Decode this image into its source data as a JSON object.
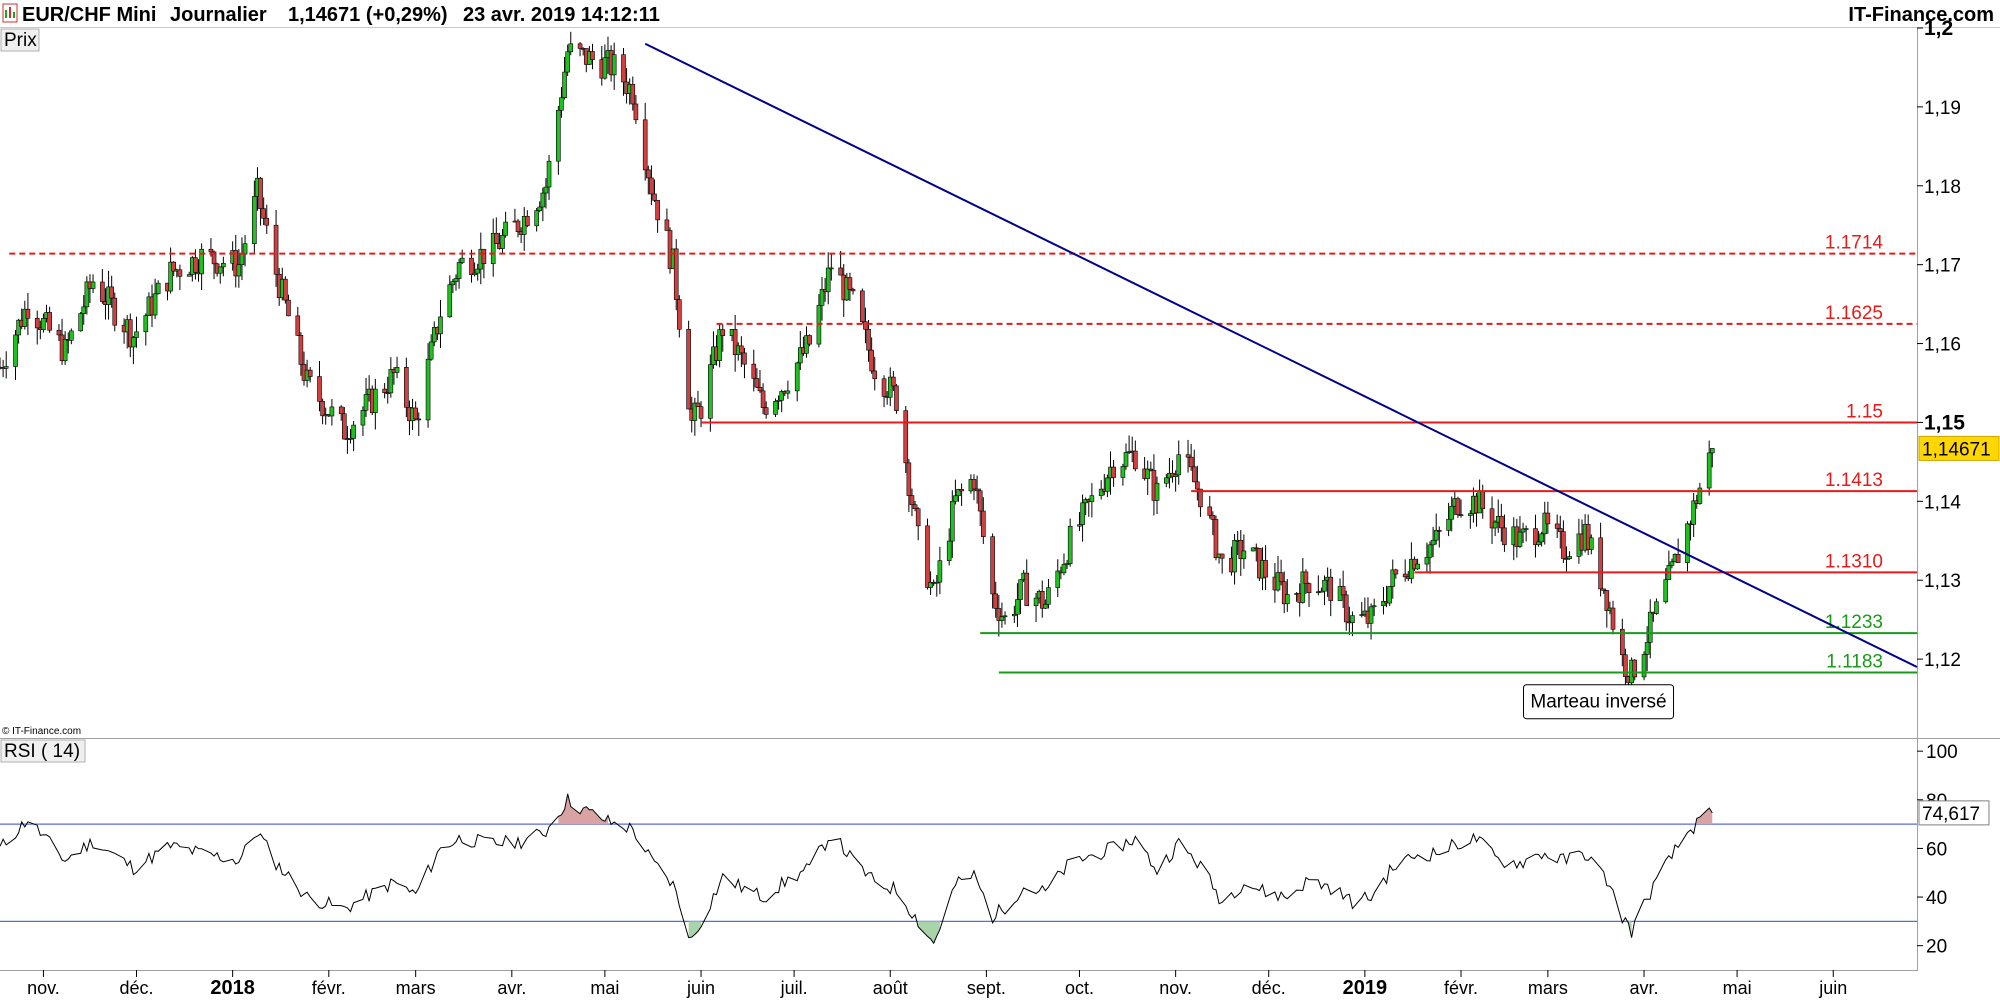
{
  "header": {
    "symbol": "EUR/CHF Mini",
    "period": "Journalier",
    "quote": "1,14671 (+0,29%)",
    "datetime": "23 avr. 2019 14:12:11",
    "brand": "IT-Finance.com"
  },
  "copyright": "© IT-Finance.com",
  "chart_data": [
    {
      "type": "candlestick",
      "title": "EUR/CHF Mini",
      "panel_label": "Prix",
      "ylim": [
        1.11,
        1.2
      ],
      "y_ticks": [
        "1,2",
        "1,19",
        "1,18",
        "1,17",
        "1,16",
        "1,15",
        "1,14",
        "1,13",
        "1,12"
      ],
      "y_bold_ticks": [
        "1,2",
        "1,15"
      ],
      "last_price_label": "1,14671",
      "last_price": 1.14671,
      "x_range": [
        "2017-10-18",
        "2019-06-28"
      ],
      "months": [
        {
          "label": "nov.",
          "date": "2017-11-01"
        },
        {
          "label": "déc.",
          "date": "2017-12-01"
        },
        {
          "label": "2018",
          "date": "2018-01-01",
          "bold": true
        },
        {
          "label": "févr.",
          "date": "2018-02-01"
        },
        {
          "label": "mars",
          "date": "2018-03-01"
        },
        {
          "label": "avr.",
          "date": "2018-04-01"
        },
        {
          "label": "mai",
          "date": "2018-05-01"
        },
        {
          "label": "juin",
          "date": "2018-06-01"
        },
        {
          "label": "juil.",
          "date": "2018-07-01"
        },
        {
          "label": "août",
          "date": "2018-08-01"
        },
        {
          "label": "sept.",
          "date": "2018-09-01"
        },
        {
          "label": "oct.",
          "date": "2018-10-01"
        },
        {
          "label": "nov.",
          "date": "2018-11-01"
        },
        {
          "label": "déc.",
          "date": "2018-12-01"
        },
        {
          "label": "2019",
          "date": "2019-01-01",
          "bold": true
        },
        {
          "label": "févr.",
          "date": "2019-02-01"
        },
        {
          "label": "mars",
          "date": "2019-03-01"
        },
        {
          "label": "avr.",
          "date": "2019-04-01"
        },
        {
          "label": "mai",
          "date": "2019-05-01"
        },
        {
          "label": "juin",
          "date": "2019-06-01"
        }
      ],
      "close_path": [
        [
          "2017-10-18",
          1.157
        ],
        [
          "2017-10-27",
          1.165
        ],
        [
          "2017-11-08",
          1.159
        ],
        [
          "2017-11-17",
          1.168
        ],
        [
          "2017-11-30",
          1.161
        ],
        [
          "2017-12-12",
          1.169
        ],
        [
          "2017-12-22",
          1.171
        ],
        [
          "2018-01-03",
          1.17
        ],
        [
          "2018-01-09",
          1.179
        ],
        [
          "2018-01-15",
          1.169
        ],
        [
          "2018-01-25",
          1.155
        ],
        [
          "2018-02-06",
          1.149
        ],
        [
          "2018-02-13",
          1.152
        ],
        [
          "2018-02-22",
          1.156
        ],
        [
          "2018-03-01",
          1.15
        ],
        [
          "2018-03-09",
          1.164
        ],
        [
          "2018-03-15",
          1.17
        ],
        [
          "2018-03-26",
          1.172
        ],
        [
          "2018-04-05",
          1.176
        ],
        [
          "2018-04-12",
          1.18
        ],
        [
          "2018-04-19",
          1.197
        ],
        [
          "2018-04-27",
          1.196
        ],
        [
          "2018-05-04",
          1.195
        ],
        [
          "2018-05-10",
          1.192
        ],
        [
          "2018-05-16",
          1.18
        ],
        [
          "2018-05-23",
          1.17
        ],
        [
          "2018-05-29",
          1.15
        ],
        [
          "2018-06-01",
          1.152
        ],
        [
          "2018-06-08",
          1.162
        ],
        [
          "2018-06-14",
          1.158
        ],
        [
          "2018-06-21",
          1.152
        ],
        [
          "2018-06-28",
          1.155
        ],
        [
          "2018-07-06",
          1.16
        ],
        [
          "2018-07-13",
          1.17
        ],
        [
          "2018-07-20",
          1.165
        ],
        [
          "2018-07-27",
          1.157
        ],
        [
          "2018-08-03",
          1.153
        ],
        [
          "2018-08-10",
          1.135
        ],
        [
          "2018-08-15",
          1.128
        ],
        [
          "2018-08-22",
          1.14
        ],
        [
          "2018-08-28",
          1.143
        ],
        [
          "2018-09-03",
          1.128
        ],
        [
          "2018-09-07",
          1.125
        ],
        [
          "2018-09-13",
          1.129
        ],
        [
          "2018-09-20",
          1.127
        ],
        [
          "2018-09-28",
          1.135
        ],
        [
          "2018-10-05",
          1.14
        ],
        [
          "2018-10-12",
          1.145
        ],
        [
          "2018-10-19",
          1.146
        ],
        [
          "2018-10-26",
          1.141
        ],
        [
          "2018-11-02",
          1.146
        ],
        [
          "2018-11-09",
          1.141
        ],
        [
          "2018-11-16",
          1.132
        ],
        [
          "2018-11-23",
          1.134
        ],
        [
          "2018-11-30",
          1.131
        ],
        [
          "2018-12-07",
          1.128
        ],
        [
          "2018-12-14",
          1.13
        ],
        [
          "2018-12-21",
          1.129
        ],
        [
          "2018-12-28",
          1.125
        ],
        [
          "2019-01-03",
          1.125
        ],
        [
          "2019-01-10",
          1.13
        ],
        [
          "2019-01-17",
          1.133
        ],
        [
          "2019-01-24",
          1.135
        ],
        [
          "2019-01-31",
          1.14
        ],
        [
          "2019-02-06",
          1.14
        ],
        [
          "2019-02-13",
          1.137
        ],
        [
          "2019-02-20",
          1.135
        ],
        [
          "2019-02-27",
          1.137
        ],
        [
          "2019-03-06",
          1.134
        ],
        [
          "2019-03-13",
          1.136
        ],
        [
          "2019-03-20",
          1.128
        ],
        [
          "2019-03-25",
          1.12
        ],
        [
          "2019-03-28",
          1.118
        ],
        [
          "2019-04-03",
          1.124
        ],
        [
          "2019-04-10",
          1.131
        ],
        [
          "2019-04-16",
          1.138
        ],
        [
          "2019-04-23",
          1.14671
        ]
      ],
      "horizontal_levels": [
        {
          "label": "1.1714",
          "value": 1.1714,
          "color": "#e41b1b",
          "style": "dashed",
          "from": "2017-10-21",
          "to": "2019-06-28"
        },
        {
          "label": "1.1625",
          "value": 1.1625,
          "color": "#e41b1b",
          "style": "dashed",
          "from": "2018-06-06",
          "to": "2019-06-28"
        },
        {
          "label": "1.15",
          "value": 1.15,
          "color": "#e41b1b",
          "style": "solid",
          "from": "2018-06-01",
          "to": "2019-06-28"
        },
        {
          "label": "1.1413",
          "value": 1.1413,
          "color": "#e41b1b",
          "style": "solid",
          "from": "2018-11-06",
          "to": "2019-06-28"
        },
        {
          "label": "1.1310",
          "value": 1.131,
          "color": "#e41b1b",
          "style": "solid",
          "from": "2019-01-17",
          "to": "2019-06-28"
        },
        {
          "label": "1.1233",
          "value": 1.1233,
          "color": "#1a9a1a",
          "style": "solid",
          "from": "2018-08-30",
          "to": "2019-06-28"
        },
        {
          "label": "1.1183",
          "value": 1.1183,
          "color": "#1a9a1a",
          "style": "solid",
          "from": "2018-09-05",
          "to": "2019-06-28"
        }
      ],
      "trendline": {
        "color": "#00008b",
        "from": [
          "2018-05-14",
          1.198
        ],
        "to": [
          "2019-06-28",
          1.119
        ]
      },
      "annotation": {
        "label": "Marteau inversé",
        "date": "2019-03-27",
        "value": 1.1146
      },
      "signal_arrow": {
        "date": "2019-03-28",
        "value": 1.1137,
        "color": "#21b121"
      }
    },
    {
      "type": "line",
      "title": "RSI ( 14)",
      "panel_label": "RSI ( 14)",
      "ylim": [
        10,
        105
      ],
      "y_ticks": [
        "100",
        "80",
        "60",
        "40",
        "20"
      ],
      "last_value_label": "74,617",
      "last_value": 74.617,
      "overbought": 70,
      "oversold": 30,
      "band_color": "#5a6cd6",
      "path": [
        [
          "2017-10-18",
          60
        ],
        [
          "2017-10-27",
          72
        ],
        [
          "2017-11-08",
          55
        ],
        [
          "2017-11-17",
          63
        ],
        [
          "2017-11-30",
          52
        ],
        [
          "2017-12-12",
          61
        ],
        [
          "2017-12-22",
          58
        ],
        [
          "2018-01-03",
          55
        ],
        [
          "2018-01-09",
          67
        ],
        [
          "2018-01-15",
          54
        ],
        [
          "2018-01-25",
          40
        ],
        [
          "2018-02-06",
          35
        ],
        [
          "2018-02-13",
          40
        ],
        [
          "2018-02-22",
          46
        ],
        [
          "2018-03-01",
          41
        ],
        [
          "2018-03-09",
          60
        ],
        [
          "2018-03-15",
          64
        ],
        [
          "2018-03-26",
          62
        ],
        [
          "2018-04-05",
          63
        ],
        [
          "2018-04-12",
          67
        ],
        [
          "2018-04-19",
          80
        ],
        [
          "2018-04-24",
          76
        ],
        [
          "2018-05-04",
          70
        ],
        [
          "2018-05-10",
          68
        ],
        [
          "2018-05-16",
          55
        ],
        [
          "2018-05-23",
          45
        ],
        [
          "2018-05-29",
          22
        ],
        [
          "2018-06-01",
          30
        ],
        [
          "2018-06-08",
          48
        ],
        [
          "2018-06-14",
          44
        ],
        [
          "2018-06-21",
          40
        ],
        [
          "2018-06-28",
          46
        ],
        [
          "2018-07-06",
          52
        ],
        [
          "2018-07-13",
          66
        ],
        [
          "2018-07-20",
          55
        ],
        [
          "2018-07-27",
          46
        ],
        [
          "2018-08-03",
          43
        ],
        [
          "2018-08-10",
          30
        ],
        [
          "2018-08-15",
          21
        ],
        [
          "2018-08-22",
          45
        ],
        [
          "2018-08-28",
          49
        ],
        [
          "2018-09-03",
          32
        ],
        [
          "2018-09-07",
          36
        ],
        [
          "2018-09-13",
          44
        ],
        [
          "2018-09-20",
          42
        ],
        [
          "2018-09-28",
          54
        ],
        [
          "2018-10-05",
          57
        ],
        [
          "2018-10-12",
          60
        ],
        [
          "2018-10-19",
          64
        ],
        [
          "2018-10-26",
          51
        ],
        [
          "2018-11-02",
          62
        ],
        [
          "2018-11-09",
          53
        ],
        [
          "2018-11-16",
          38
        ],
        [
          "2018-11-23",
          46
        ],
        [
          "2018-11-30",
          42
        ],
        [
          "2018-12-07",
          40
        ],
        [
          "2018-12-14",
          47
        ],
        [
          "2018-12-21",
          44
        ],
        [
          "2018-12-28",
          38
        ],
        [
          "2019-01-03",
          40
        ],
        [
          "2019-01-10",
          52
        ],
        [
          "2019-01-17",
          57
        ],
        [
          "2019-01-24",
          58
        ],
        [
          "2019-01-31",
          62
        ],
        [
          "2019-02-06",
          64
        ],
        [
          "2019-02-13",
          55
        ],
        [
          "2019-02-20",
          54
        ],
        [
          "2019-02-27",
          58
        ],
        [
          "2019-03-06",
          55
        ],
        [
          "2019-03-13",
          58
        ],
        [
          "2019-03-20",
          47
        ],
        [
          "2019-03-25",
          32
        ],
        [
          "2019-03-28",
          26
        ],
        [
          "2019-04-03",
          42
        ],
        [
          "2019-04-10",
          57
        ],
        [
          "2019-04-16",
          68
        ],
        [
          "2019-04-23",
          74.6
        ]
      ]
    }
  ]
}
